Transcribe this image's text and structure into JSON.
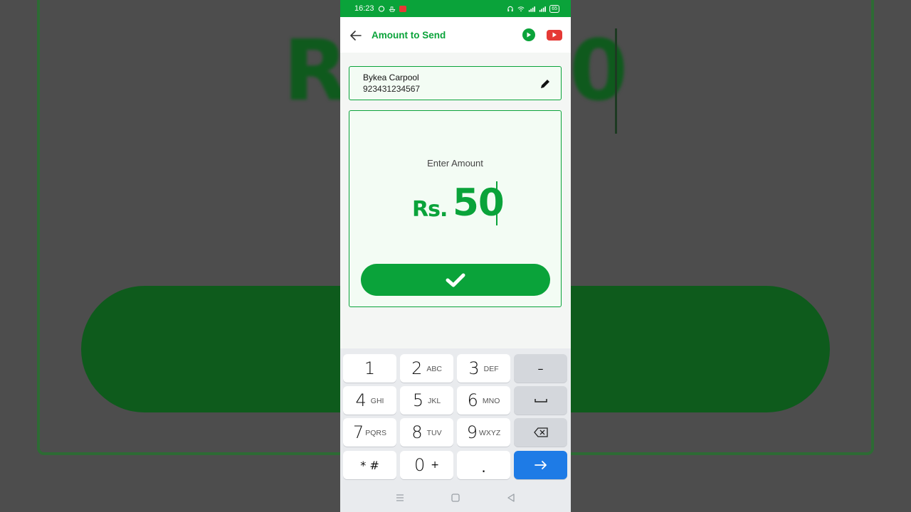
{
  "status_bar": {
    "time": "16:23",
    "battery": "65",
    "left_icons": [
      "whatsapp-icon",
      "boat-icon",
      "notification-icon"
    ],
    "right_icons": [
      "headphones-icon",
      "wifi-icon",
      "signal-icon",
      "signal-icon",
      "battery-icon"
    ]
  },
  "app_bar": {
    "title": "Amount to Send",
    "back_icon": "arrow-left-icon",
    "action_icons": [
      "play-circle-icon",
      "youtube-icon"
    ]
  },
  "recipient": {
    "name": "Bykea Carpool",
    "phone": "923431234567",
    "edit_icon": "pencil-icon"
  },
  "amount": {
    "label": "Enter Amount",
    "currency": "Rs.",
    "value": "50",
    "confirm_icon": "checkmark-icon"
  },
  "keyboard": {
    "keys": [
      {
        "num": "1",
        "letters": ""
      },
      {
        "num": "2",
        "letters": "ABC"
      },
      {
        "num": "3",
        "letters": "DEF"
      },
      {
        "num": "4",
        "letters": "GHI"
      },
      {
        "num": "5",
        "letters": "JKL"
      },
      {
        "num": "6",
        "letters": "MNO"
      },
      {
        "num": "7",
        "letters": "PQRS"
      },
      {
        "num": "8",
        "letters": "TUV"
      },
      {
        "num": "9",
        "letters": "WXYZ"
      },
      {
        "num": "* #",
        "letters": ""
      },
      {
        "num": "0",
        "letters": "+"
      },
      {
        "num": ".",
        "letters": ""
      }
    ],
    "function_keys": [
      "minus",
      "space",
      "backspace-icon",
      "enter-arrow-icon"
    ],
    "minus_label": "–"
  },
  "background": {
    "text_left": "R",
    "text_right": "0"
  },
  "colors": {
    "brand_green": "#0aa33a",
    "enter_blue": "#1e7be6",
    "notification_red": "#e53935"
  }
}
